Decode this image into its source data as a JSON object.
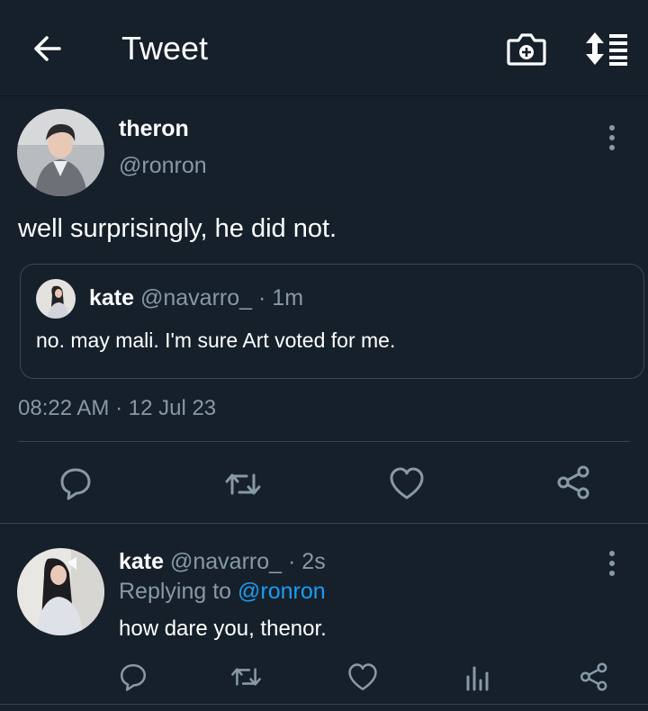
{
  "header": {
    "title": "Tweet",
    "back_icon": "arrow-left-icon",
    "camera_icon": "camera-plus-icon",
    "sort_icon": "sort-icon"
  },
  "tweet": {
    "author_name": "theron",
    "author_handle": "@ronron",
    "text": "well surprisingly, he did not.",
    "quote": {
      "name": "kate",
      "handle": "@navarro_",
      "separator": "·",
      "time": "1m",
      "text": "no. may mali. I'm sure Art voted for me."
    },
    "timestamp": "08:22 AM · 12 Jul 23",
    "actions": [
      "reply-icon",
      "retweet-icon",
      "like-icon",
      "share-icon"
    ]
  },
  "reply": {
    "name": "kate",
    "handle": "@navarro_",
    "separator": "·",
    "time": "2s",
    "replying_prefix": "Replying to",
    "replying_to": "@ronron",
    "text": "how dare you, thenor.",
    "actions": [
      "reply-icon",
      "retweet-icon",
      "like-icon",
      "stats-icon",
      "share-icon"
    ]
  },
  "colors": {
    "background": "#15202b",
    "muted": "#8899a6",
    "accent": "#1d9bf0",
    "border": "#38444d"
  }
}
